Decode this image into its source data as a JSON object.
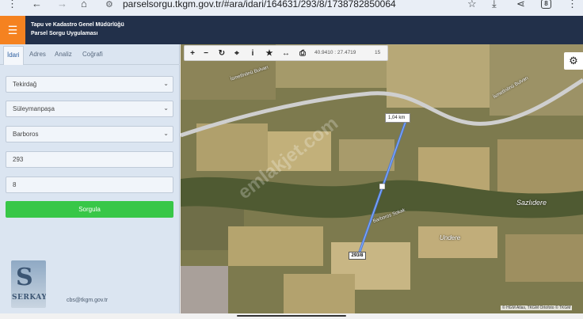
{
  "browser": {
    "url": "parselsorgu.tkgm.gov.tr/#ara/idari/164631/293/8/1738782850064",
    "tab_count": "8"
  },
  "app": {
    "title_line1": "Tapu ve Kadastro Genel Müdürlüğü",
    "title_line2": "Parsel Sorgu Uygulaması"
  },
  "sidebar": {
    "tabs": [
      {
        "label": "İdari",
        "active": true
      },
      {
        "label": "Adres",
        "active": false
      },
      {
        "label": "Analiz",
        "active": false
      },
      {
        "label": "Coğrafi",
        "active": false
      }
    ],
    "province": "Tekirdağ",
    "district": "Süleymanpaşa",
    "neighborhood": "Barboros",
    "block": "293",
    "parcel": "8",
    "query_button": "Sorgula",
    "logo_text": "SERKAY",
    "email": "cbs@tkgm.gov.tr"
  },
  "map": {
    "coordinates": "40.9410 : 27.4719",
    "zoom": "15",
    "distance_label": "1,04 km",
    "parcel_label": "293/8",
    "places": [
      "Sazlıdere",
      "Undere"
    ],
    "roads": [
      "İsmetİnönü Bulvarı",
      "İsmetİnönü Bulvarı",
      "Barboros Sokak"
    ],
    "watermark": "emlakjet.com",
    "attribution": "© HGM Atlas, TKGM Ortofoto © TKGM"
  },
  "colors": {
    "header": "#22304a",
    "menu": "#f58220",
    "query": "#38c748",
    "sidebar": "#dbe5f1"
  }
}
